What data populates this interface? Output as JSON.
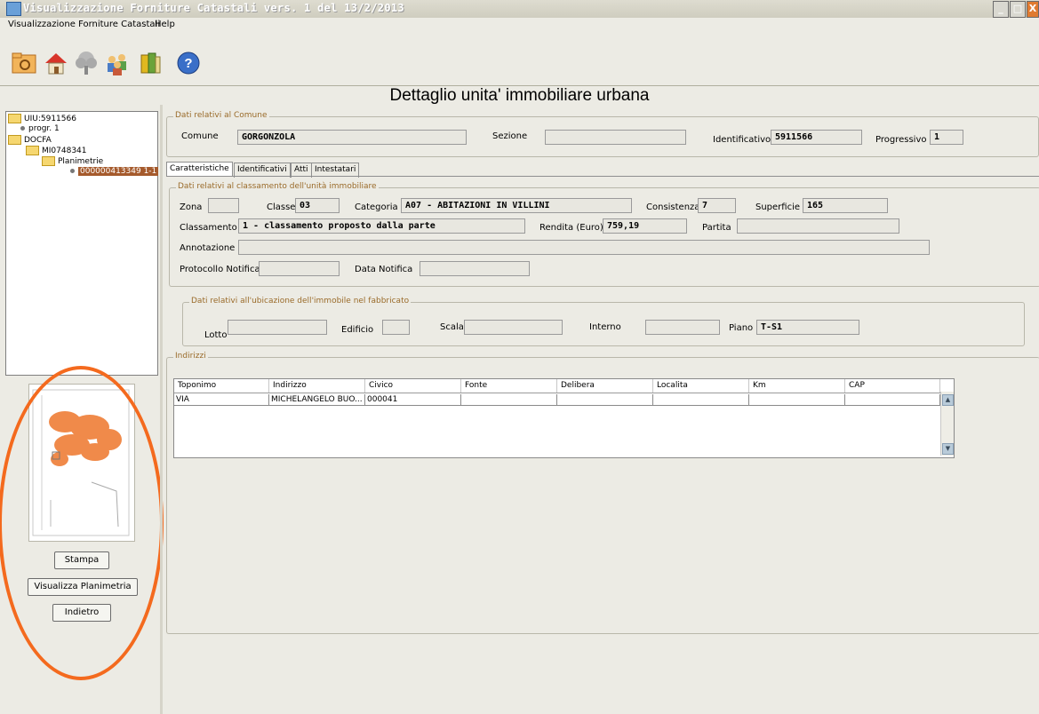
{
  "window": {
    "title": "Visualizzazione Forniture Catastali vers. 1 del 13/2/2013",
    "controls": [
      "_",
      "□",
      "X"
    ]
  },
  "menu": [
    "Visualizzazione Forniture Catastali",
    "Help"
  ],
  "toolbar": [
    "open-icon",
    "house-icon",
    "tree-icon",
    "people-icon",
    "books-icon",
    "help-icon"
  ],
  "heading": "Dettaglio unita' immobiliare urbana",
  "tree": {
    "root": "UIU:5911566",
    "progr": "progr. 1",
    "docfa": "DOCFA",
    "mi": "MI0748341",
    "planimetrie": "Planimetrie",
    "selected": "000000413349 1-1"
  },
  "left_buttons": {
    "stampa": "Stampa",
    "visualizza": "Visualizza Planimetria",
    "indietro": "Indietro"
  },
  "comune": {
    "group_label": "Dati relativi al Comune",
    "comune_label": "Comune",
    "comune_value": "GORGONZOLA",
    "sezione_label": "Sezione",
    "sezione_value": "",
    "identificativo_label": "Identificativo",
    "identificativo_value": "5911566",
    "progressivo_label": "Progressivo",
    "progressivo_value": "1"
  },
  "tabs": [
    "Caratteristiche",
    "Identificativi",
    "Atti",
    "Intestatari"
  ],
  "classamento": {
    "group_label": "Dati relativi al classamento dell'unità immobiliare",
    "zona_label": "Zona",
    "zona_value": "",
    "classe_label": "Classe",
    "classe_value": "03",
    "categoria_label": "Categoria",
    "categoria_value": "A07 - ABITAZIONI IN VILLINI",
    "consistenza_label": "Consistenza",
    "consistenza_value": "7",
    "superficie_label": "Superficie",
    "superficie_value": "165",
    "classamento_label": "Classamento",
    "classamento_value": "1 - classamento proposto dalla parte",
    "rendita_label": "Rendita (Euro)",
    "rendita_value": "759,19",
    "partita_label": "Partita",
    "partita_value": "",
    "annotazione_label": "Annotazione",
    "annotazione_value": "",
    "protocollo_label": "Protocollo Notifica",
    "protocollo_value": "",
    "data_label": "Data Notifica",
    "data_value": ""
  },
  "ubicazione": {
    "group_label": "Dati relativi all'ubicazione dell'immobile nel fabbricato",
    "lotto_label": "Lotto",
    "edificio_label": "Edificio",
    "scala_label": "Scala",
    "interno_label": "Interno",
    "piano_label": "Piano",
    "piano_value": "T-S1"
  },
  "indirizzi": {
    "group_label": "Indirizzi",
    "columns": [
      "Toponimo",
      "Indirizzo",
      "Civico",
      "Fonte",
      "Delibera",
      "Localita",
      "Km",
      "CAP"
    ],
    "rows": [
      [
        "VIA",
        "MICHELANGELO BUO...",
        "000041",
        "",
        "",
        "",
        "",
        ""
      ]
    ]
  },
  "colors": {
    "background": "#ecebe4",
    "selection": "#a55a2c",
    "annotation_oval": "#f46a1e",
    "group_label": "#9a6b2a"
  }
}
